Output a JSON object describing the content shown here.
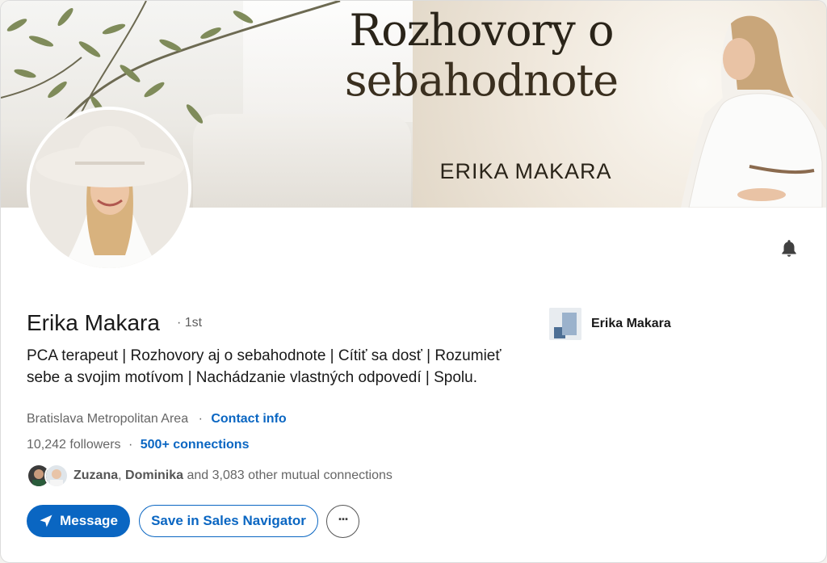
{
  "banner": {
    "title_line1": "Rozhovory o",
    "title_line2": "sebahodnote",
    "subtitle": "ERIKA MAKARA"
  },
  "profile": {
    "name": "Erika Makara",
    "degree": "· 1st",
    "headline": "PCA terapeut | Rozhovory aj o sebahodnote | Cítiť sa dosť | Rozumieť sebe a svojim motívom | Nachádzanie vlastných odpovedí | Spolu.",
    "location": "Bratislava Metropolitan Area",
    "contact_info_label": "Contact info",
    "followers": "10,242 followers",
    "connections": "500+ connections",
    "mutual": {
      "name1": "Zuzana",
      "name2": "Dominika",
      "rest": "and 3,083 other mutual connections"
    }
  },
  "actions": {
    "message_label": "Message",
    "sales_navigator_label": "Save in Sales Navigator",
    "more_label": "···"
  },
  "company": {
    "name": "Erika Makara"
  },
  "icons": {
    "bell": "bell-icon",
    "send": "paper-plane-icon",
    "more": "ellipsis-icon"
  },
  "colors": {
    "accent": "#0a66c2",
    "text": "#191919",
    "muted": "#666666"
  }
}
